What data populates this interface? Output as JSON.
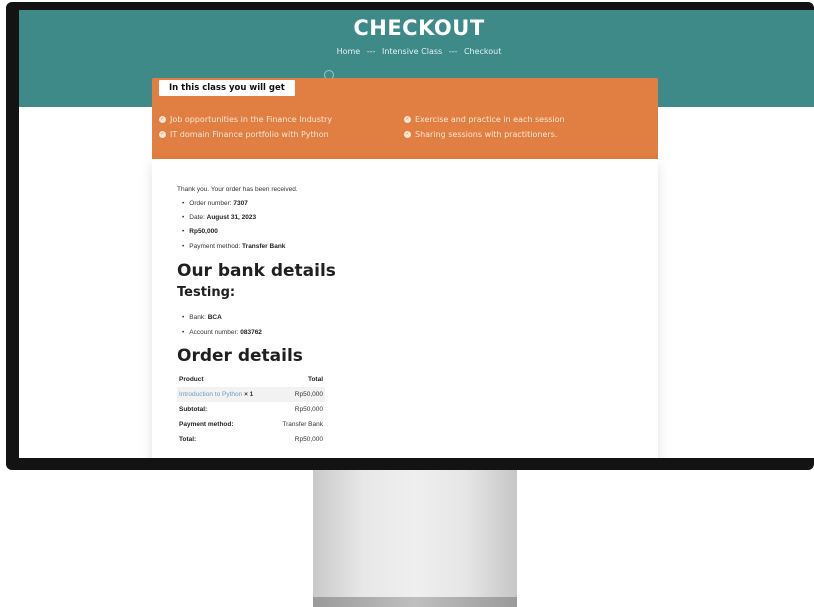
{
  "hero": {
    "title": "CHECKOUT",
    "breadcrumb": [
      "Home",
      "Intensive Class",
      "Checkout"
    ],
    "separator": "---"
  },
  "benefits": {
    "tab_label": "In this class you will get",
    "items": [
      "Job opportunities in the Finance Industry",
      "Exercise and practice in each session",
      "IT domain Finance portfolio with Python",
      "Sharing sessions with practitioners."
    ]
  },
  "order": {
    "thank_you": "Thank you. Your order has been received.",
    "number_label": "Order number:",
    "number": "7307",
    "date_label": "Date:",
    "date": "August 31, 2023",
    "total": "Rp50,000",
    "payment_label": "Payment method:",
    "payment": "Transfer Bank"
  },
  "bank": {
    "heading": "Our bank details",
    "subheading": "Testing:",
    "bank_label": "Bank:",
    "bank": "BCA",
    "account_label": "Account number:",
    "account": "083762"
  },
  "details": {
    "heading": "Order details",
    "col_product": "Product",
    "col_total": "Total",
    "product_name": "Introduction to Python",
    "product_qty": "× 1",
    "product_price": "Rp50,000",
    "subtotal_label": "Subtotal:",
    "subtotal": "Rp50,000",
    "payment_label": "Payment method:",
    "payment": "Transfer Bank",
    "total_label": "Total:",
    "total": "Rp50,000"
  },
  "colors": {
    "header_teal": "#3d8a89",
    "orange": "#e17e42",
    "link_blue": "#6b9bc3"
  }
}
